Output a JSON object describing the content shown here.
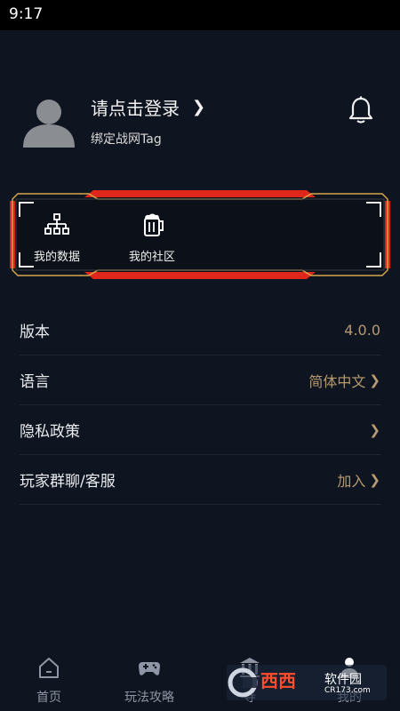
{
  "status": {
    "time": "9:17"
  },
  "profile": {
    "title": "请点击登录",
    "arrow": "❯",
    "subtitle": "绑定战网Tag"
  },
  "card": {
    "items": [
      {
        "label": "我的数据",
        "icon": "hierarchy-icon"
      },
      {
        "label": "我的社区",
        "icon": "beer-mug-icon"
      }
    ]
  },
  "settings": {
    "rows": [
      {
        "label": "版本",
        "value": "4.0.0",
        "chevron": ""
      },
      {
        "label": "语言",
        "value": "简体中文",
        "chevron": "❯"
      },
      {
        "label": "隐私政策",
        "value": "",
        "chevron": "❯"
      },
      {
        "label": "玩家群聊/客服",
        "value": "加入",
        "chevron": "❯"
      }
    ]
  },
  "nav": {
    "items": [
      {
        "label": "首页",
        "icon": "home-icon"
      },
      {
        "label": "玩法攻略",
        "icon": "gamepad-icon"
      },
      {
        "label": "寺",
        "icon": "temple-icon"
      },
      {
        "label": "我的",
        "icon": "person-icon"
      }
    ]
  },
  "watermark": {
    "brand": "西西",
    "name": "软件园",
    "domain": "CR173.com"
  },
  "colors": {
    "accent": "#b79a6f",
    "background": "#0f1520",
    "frame_red": "#e0271b",
    "frame_gold": "#d6a64a"
  }
}
